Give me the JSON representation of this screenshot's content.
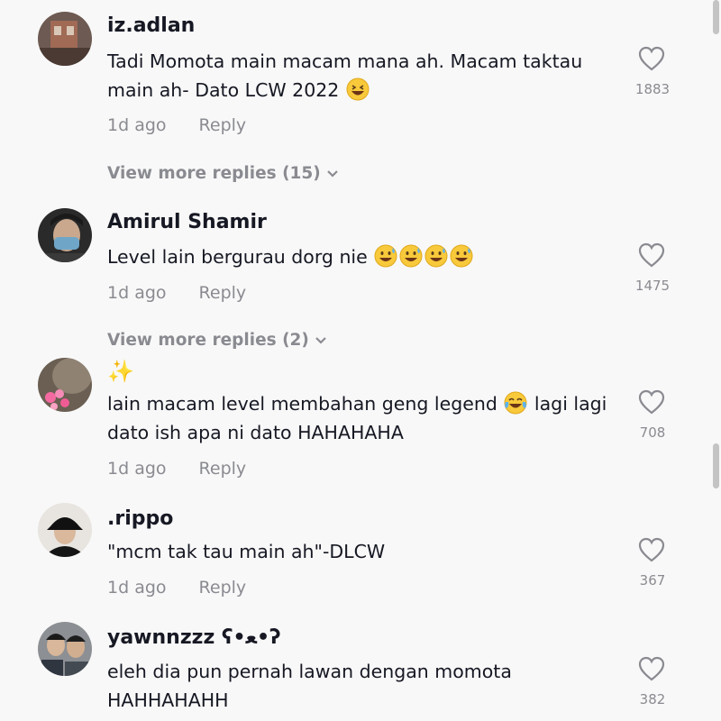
{
  "comments": [
    {
      "username": "iz.adlan",
      "text": "Tadi Momota main macam mana ah. Macam taktau main ah- Dato LCW 2022",
      "time": "1d ago",
      "reply_label": "Reply",
      "likes": "1883",
      "view_more": "View more replies (15)"
    },
    {
      "username": "Amirul Shamir",
      "text": "Level lain bergurau dorg nie",
      "time": "1d ago",
      "reply_label": "Reply",
      "likes": "1475",
      "view_more": "View more replies (2)"
    },
    {
      "username": "✨",
      "text_line1": "lain macam level membahan geng legend",
      "text_line1b": "lagi lagi",
      "text_line2": "dato ish apa ni dato HAHAHAHA",
      "time": "1d ago",
      "reply_label": "Reply",
      "likes": "708"
    },
    {
      "username": ".rippo",
      "text": "\"mcm tak tau main ah\"-DLCW",
      "time": "1d ago",
      "reply_label": "Reply",
      "likes": "367"
    },
    {
      "username": "yawnnzzz ʕ•ﻌ•ʔ",
      "text_line1": "eleh dia pun pernah lawan dengan momota",
      "text_line2": "HAHHAHAHH",
      "likes": "382"
    }
  ],
  "icons": {
    "like": "heart-outline-icon",
    "expand": "chevron-down-icon",
    "emoji_grin": "grinning-squinting-face",
    "emoji_sweat": "grinning-face-with-sweat",
    "emoji_joy": "face-with-tears-of-joy"
  },
  "colors": {
    "background": "#f8f8f8",
    "text": "#161823",
    "muted": "#8a8b91"
  }
}
